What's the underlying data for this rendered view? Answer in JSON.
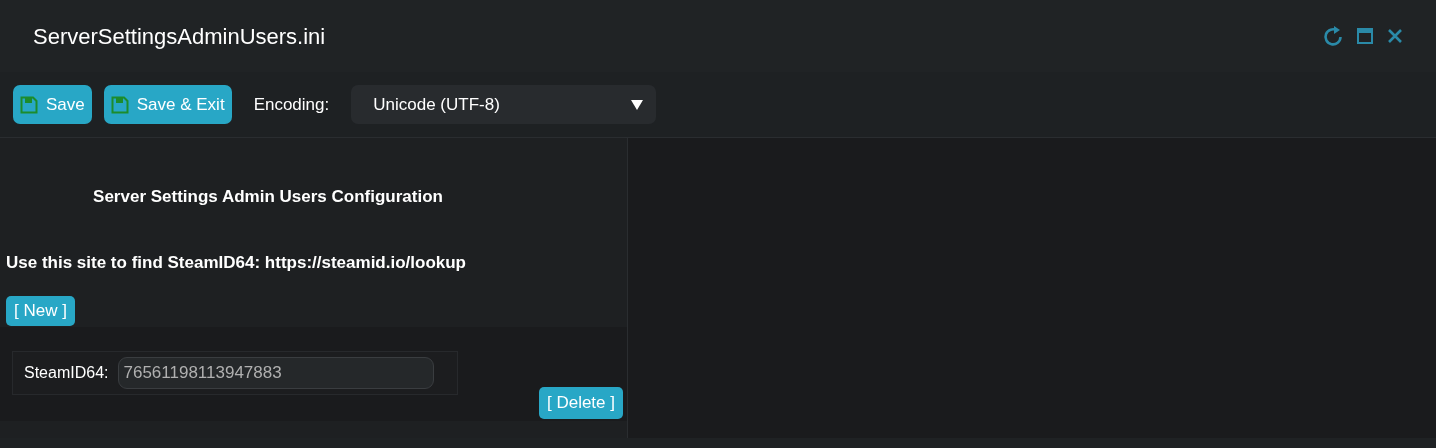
{
  "window": {
    "title": "ServerSettingsAdminUsers.ini"
  },
  "toolbar": {
    "buttons": [
      {
        "label": "Save"
      },
      {
        "label": "Save & Exit"
      }
    ],
    "encoding_label": "Encoding:",
    "encoding_value": "Unicode (UTF-8)"
  },
  "editor": {
    "heading": "Server Settings Admin Users Configuration",
    "hint": "Use this site to find SteamID64: https://steamid.io/lookup",
    "new_button": "[ New ]",
    "entries": [
      {
        "label": "SteamID64:",
        "value": "76561198113947883",
        "delete_button": "[ Delete ]"
      }
    ]
  }
}
